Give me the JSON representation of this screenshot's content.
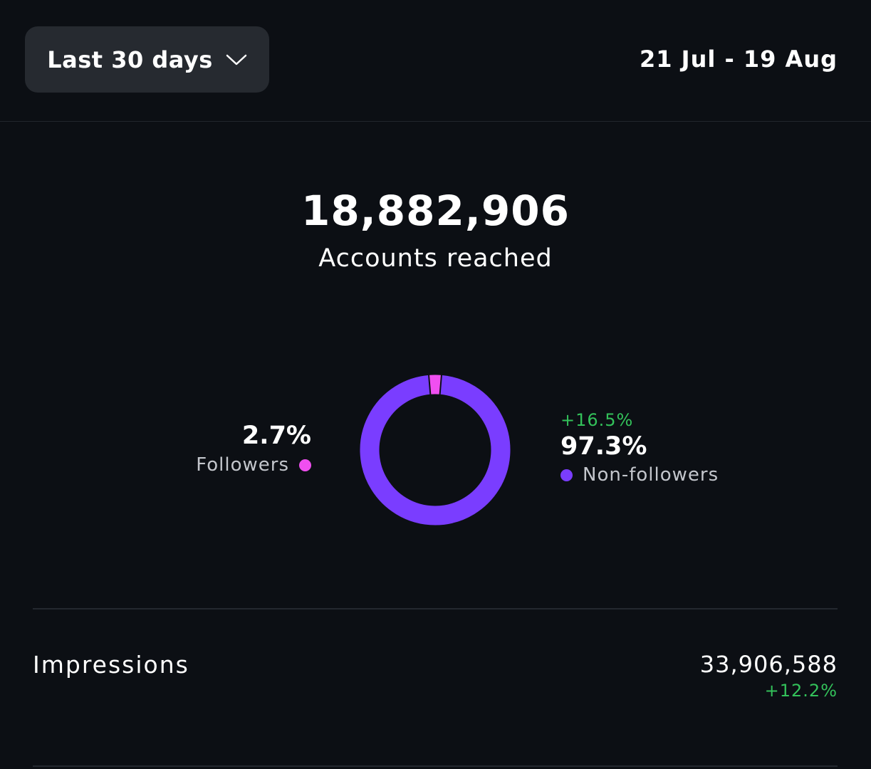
{
  "header": {
    "range_label": "Last 30 days",
    "date_range": "21 Jul - 19 Aug"
  },
  "reach": {
    "value": "18,882,906",
    "label": "Accounts reached"
  },
  "chart_data": {
    "type": "pie",
    "categories": [
      "Followers",
      "Non-followers"
    ],
    "values": [
      2.7,
      97.3
    ],
    "colors": [
      "#f04ff0",
      "#7a3dff"
    ],
    "labels": [
      "2.7%",
      "97.3%"
    ],
    "annotations": [
      "+16.5%"
    ]
  },
  "followers": {
    "pct": "2.7%",
    "label": "Followers",
    "color": "#f04ff0"
  },
  "nonfollowers": {
    "change": "+16.5%",
    "pct": "97.3%",
    "label": "Non-followers",
    "color": "#7a3dff"
  },
  "impressions": {
    "label": "Impressions",
    "value": "33,906,588",
    "change": "+12.2%"
  },
  "colors": {
    "background": "#0c0f14",
    "button": "#262a30",
    "positive": "#33c15a"
  }
}
